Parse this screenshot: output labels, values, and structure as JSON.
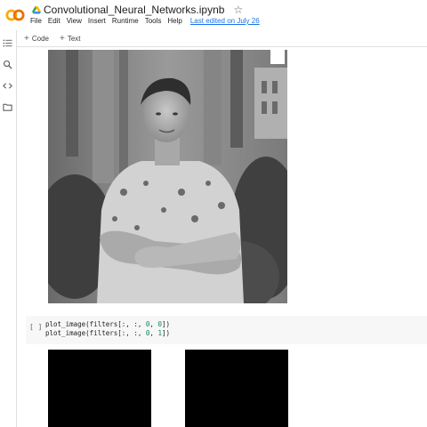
{
  "header": {
    "doc_title": "Convolutional_Neural_Networks.ipynb",
    "last_edited": "Last edited on July 26",
    "menu": [
      "File",
      "Edit",
      "View",
      "Insert",
      "Runtime",
      "Tools",
      "Help"
    ]
  },
  "toolbar": {
    "code_label": "Code",
    "text_label": "Text"
  },
  "cell": {
    "run_label": "[ ]",
    "lines": [
      {
        "pre": "plot_image(filters[:, :, ",
        "a": "0",
        "mid": ", ",
        "b": "0",
        "post": "])"
      },
      {
        "pre": "plot_image(filters[:, :, ",
        "a": "0",
        "mid": ", ",
        "b": "1",
        "post": "])"
      }
    ]
  },
  "icons": {
    "logo": "colab-logo",
    "drive": "drive-icon",
    "star": "star-icon",
    "rail": [
      "table-of-contents-icon",
      "search-icon",
      "code-snippets-icon",
      "files-icon"
    ]
  },
  "colors": {
    "accent": "#1a73e8",
    "logo_orange": "#f9ab00",
    "logo_dark": "#e8710a"
  }
}
